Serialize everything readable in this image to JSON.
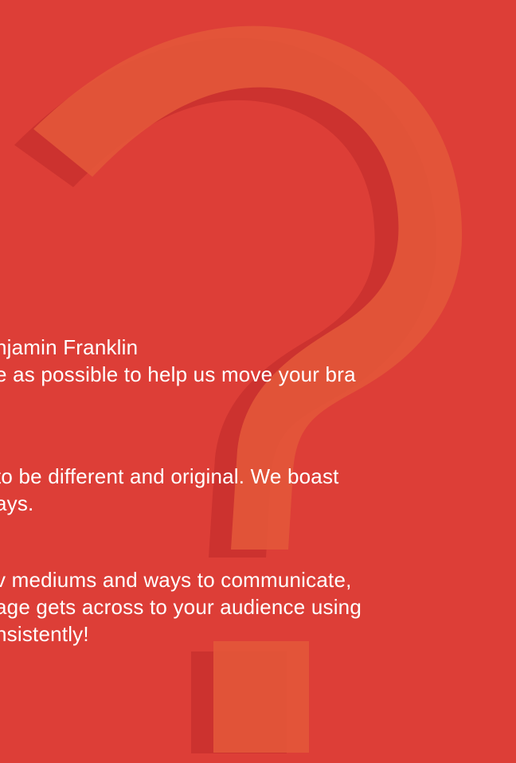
{
  "colors": {
    "background": "#dd3e37",
    "shape_light": "#e3573a",
    "shape_dark": "#c9302e",
    "text": "#ffffff"
  },
  "decoration": {
    "icon": "question-mark-icon"
  },
  "content": {
    "lines": [
      "njamin Franklin",
      "e as possible to help us move your bra",
      "to be different and original. We boast",
      "ays.",
      "v mediums and ways to communicate,",
      "age gets across to your audience using",
      "nsistently!"
    ]
  }
}
